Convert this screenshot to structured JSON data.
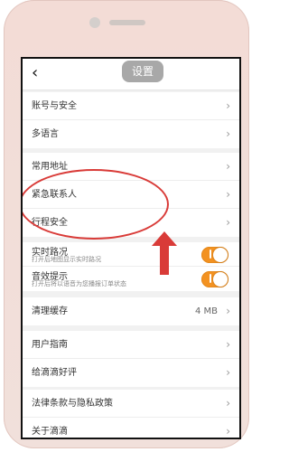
{
  "header": {
    "back_icon": "chevron-left-icon",
    "title": "设置"
  },
  "sections": {
    "account": [
      {
        "label": "账号与安全"
      },
      {
        "label": "多语言"
      }
    ],
    "address": [
      {
        "label": "常用地址"
      },
      {
        "label": "紧急联系人"
      },
      {
        "label": "行程安全"
      }
    ],
    "toggles": [
      {
        "label": "实时路况",
        "sub": "打开后地图显示实时路况",
        "enabled": true
      },
      {
        "label": "音效提示",
        "sub": "打开后将以语音为您播报订单状态",
        "enabled": true
      }
    ],
    "cache": {
      "label": "清理缓存",
      "value": "4 MB"
    },
    "help": [
      {
        "label": "用户指南"
      },
      {
        "label": "给滴滴好评"
      }
    ],
    "legal": [
      {
        "label": "法律条款与隐私政策"
      },
      {
        "label": "关于滴滴"
      }
    ]
  },
  "colors": {
    "accent": "#f39221",
    "annotation": "#d93b38"
  }
}
